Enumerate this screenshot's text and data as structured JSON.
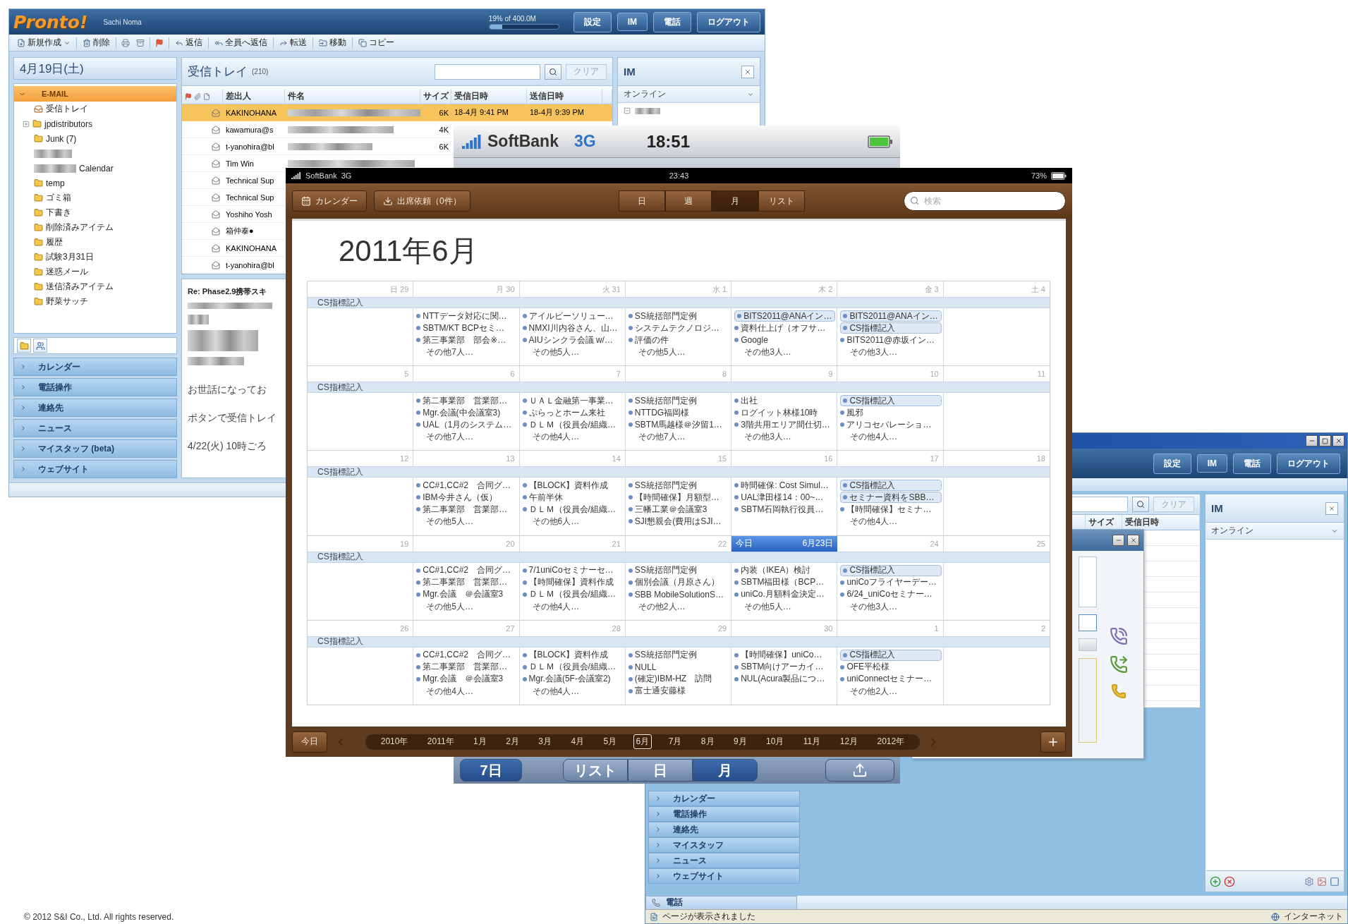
{
  "mail_window": {
    "logo": "Pronto!",
    "user": "Sachi Noma",
    "quota": {
      "reading": "19% of 400.0M",
      "level": 0.19
    },
    "header_buttons": [
      "設定",
      "IM",
      "電話",
      "ログアウト"
    ],
    "toolbar": [
      "新規作成",
      "削除",
      "返信",
      "全員へ返信",
      "転送",
      "移動",
      "コピー"
    ],
    "date": "4月19日(土)",
    "section": {
      "label": "E-MAIL",
      "expanded": true
    },
    "folders": [
      {
        "kind": "inbox",
        "label": "受信トレイ"
      },
      {
        "kind": "collapsed",
        "label": "jpdistributors"
      },
      {
        "kind": "folder",
        "label": "Junk (7)"
      },
      {
        "kind": "redacted"
      },
      {
        "kind": "partly-redacted",
        "label": "Calendar"
      },
      {
        "kind": "folder",
        "label": "temp"
      },
      {
        "kind": "folder",
        "label": "ゴミ箱"
      },
      {
        "kind": "folder",
        "label": "下書き"
      },
      {
        "kind": "folder",
        "label": "削除済みアイテム"
      },
      {
        "kind": "folder",
        "label": "履歴"
      },
      {
        "kind": "folder",
        "label": "試験3月31日"
      },
      {
        "kind": "folder",
        "label": "迷惑メール"
      },
      {
        "kind": "folder",
        "label": "送信済みアイテム"
      },
      {
        "kind": "folder",
        "label": "野菜サッチ"
      }
    ],
    "nav": [
      "カレンダー",
      "電話操作",
      "連絡先",
      "ニュース",
      "マイスタッフ (beta)",
      "ウェブサイト"
    ],
    "list": {
      "title": "受信トレイ",
      "count": "(210)",
      "clear": "クリア",
      "columns": [
        "差出人",
        "件名",
        "サイズ",
        "受信日時",
        "送信日時"
      ],
      "rows": [
        {
          "from": "KAKINOHANA",
          "size": "6K",
          "received": "18-4月 9:41 PM",
          "sent": "18-4月 9:39 PM",
          "selected": true
        },
        {
          "from": "kawamura@s",
          "size": "4K",
          "selected": false
        },
        {
          "from": "t-yanohira@bl",
          "size": "6K",
          "selected": false
        },
        {
          "from": "Tim Win",
          "selected": false
        },
        {
          "from": "Technical Sup",
          "selected": false
        },
        {
          "from": "Technical Sup",
          "selected": false
        },
        {
          "from": "Yoshiho Yosh",
          "selected": false
        },
        {
          "from": "箱仲泰●",
          "selected": false
        },
        {
          "from": "KAKINOHANA",
          "selected": false
        },
        {
          "from": "t-yanohira@bl",
          "selected": false
        }
      ]
    },
    "preview": {
      "subject": "Re: Phase2.9携帯スキ",
      "lines": [
        "お世話になってお",
        "ボタンで受信トレイ",
        "4/22(火) 10時ごろ"
      ]
    },
    "im": {
      "title": "IM",
      "status": "オンライン"
    }
  },
  "desktop_window": {
    "header_buttons": [
      "設定",
      "IM",
      "電話",
      "ログアウト"
    ],
    "clear": "クリア",
    "columns": [
      "サイズ",
      "受信日時"
    ],
    "im": {
      "title": "IM",
      "status": "オンライン"
    },
    "nav": [
      "カレンダー",
      "電話操作",
      "連絡先",
      "マイスタッフ",
      "ニュース",
      "ウェブサイト"
    ],
    "phone_tab": "電話",
    "status_text": "ページが表示されました",
    "zone": "インターネット"
  },
  "phone": {
    "carrier": "SoftBank",
    "network": "3G",
    "time": "18:51",
    "left_button": "7日",
    "tabs": [
      {
        "label": "リスト",
        "selected": false
      },
      {
        "label": "日",
        "selected": false
      },
      {
        "label": "月",
        "selected": true
      }
    ]
  },
  "ipad": {
    "carrier": "SoftBank",
    "network": "3G",
    "time": "23:43",
    "battery": "73%",
    "calendars": "カレンダー",
    "invites": "出席依頼（0件）",
    "views": [
      {
        "label": "日",
        "selected": false
      },
      {
        "label": "週",
        "selected": false
      },
      {
        "label": "月",
        "selected": true
      },
      {
        "label": "リスト",
        "selected": false
      }
    ],
    "search_placeholder": "検索",
    "title": "2011年6月",
    "weeks": [
      {
        "days": [
          {
            "kind": "day",
            "label": "日 29"
          },
          {
            "kind": "day",
            "label": "月 30"
          },
          {
            "kind": "day",
            "label": "火 31"
          },
          {
            "kind": "day",
            "label": "水 1"
          },
          {
            "kind": "day",
            "label": "木 2"
          },
          {
            "kind": "day",
            "label": "金 3"
          },
          {
            "kind": "day",
            "label": "土 4"
          }
        ],
        "band": "CS指標記入",
        "events": [
          [
            {
              "kind": "timed",
              "text": "NTTデータ対応に関…"
            },
            {
              "kind": "timed",
              "text": "SBTM/KT BCPセミ…"
            },
            {
              "kind": "timed",
              "text": "第三事業部　部会※…"
            },
            {
              "kind": "more",
              "text": "その他7人…"
            }
          ],
          [
            {
              "kind": "timed",
              "text": "アイルビーソリュー…"
            },
            {
              "kind": "timed",
              "text": "NMXI川内谷さん、山…"
            },
            {
              "kind": "timed",
              "text": "AIUシンクラ会議 w/…"
            },
            {
              "kind": "more",
              "text": "その他5人…"
            }
          ],
          [
            {
              "kind": "timed",
              "text": "SS統括部門定例"
            },
            {
              "kind": "timed",
              "text": "システムテクノロジ…"
            },
            {
              "kind": "timed",
              "text": "評価の件"
            },
            {
              "kind": "more",
              "text": "その他5人…"
            }
          ],
          [
            {
              "kind": "allday",
              "text": "BITS2011@ANAイン…"
            },
            {
              "kind": "timed",
              "text": "資料仕上げ（オフサ…"
            },
            {
              "kind": "timed",
              "text": "Google"
            },
            {
              "kind": "more",
              "text": "その他3人…"
            }
          ],
          [
            {
              "kind": "allday",
              "text": "BITS2011@ANAイン…"
            },
            {
              "kind": "allday",
              "text": "CS指標記入"
            },
            {
              "kind": "timed",
              "text": "BITS2011@赤坂イン…"
            },
            {
              "kind": "more",
              "text": "その他3人…"
            }
          ]
        ]
      },
      {
        "days": [
          {
            "kind": "day",
            "label": "5"
          },
          {
            "kind": "day",
            "label": "6"
          },
          {
            "kind": "day",
            "label": "7"
          },
          {
            "kind": "day",
            "label": "8"
          },
          {
            "kind": "day",
            "label": "9"
          },
          {
            "kind": "day",
            "label": "10"
          },
          {
            "kind": "day",
            "label": "11"
          }
        ],
        "band": "CS指標記入",
        "events": [
          [
            {
              "kind": "timed",
              "text": "第二事業部　営業部…"
            },
            {
              "kind": "timed",
              "text": "Mgr.会議(中会議室3)"
            },
            {
              "kind": "timed",
              "text": "UAL（1月のシステム…"
            },
            {
              "kind": "more",
              "text": "その他7人…"
            }
          ],
          [
            {
              "kind": "timed",
              "text": "ＵＡＬ金融第一事業…"
            },
            {
              "kind": "timed",
              "text": "ぷらっとホーム来社"
            },
            {
              "kind": "timed",
              "text": "ＤＬＭ（役員会/組織…"
            },
            {
              "kind": "more",
              "text": "その他4人…"
            }
          ],
          [
            {
              "kind": "timed",
              "text": "SS統括部門定例"
            },
            {
              "kind": "timed",
              "text": "NTTDG福岡様"
            },
            {
              "kind": "timed",
              "text": "SBTM馬越様＠汐留1…"
            },
            {
              "kind": "more",
              "text": "その他7人…"
            }
          ],
          [
            {
              "kind": "timed",
              "text": "出社"
            },
            {
              "kind": "timed",
              "text": "ログイット林様10時"
            },
            {
              "kind": "timed",
              "text": "3階共用エリア間仕切…"
            },
            {
              "kind": "more",
              "text": "その他3人…"
            }
          ],
          [
            {
              "kind": "allday",
              "text": "CS指標記入"
            },
            {
              "kind": "timed",
              "text": "風邪"
            },
            {
              "kind": "timed",
              "text": "アリコセパレーショ…"
            },
            {
              "kind": "more",
              "text": "その他4人…"
            }
          ]
        ]
      },
      {
        "days": [
          {
            "kind": "day",
            "label": "12"
          },
          {
            "kind": "day",
            "label": "13"
          },
          {
            "kind": "day",
            "label": "14"
          },
          {
            "kind": "day",
            "label": "15"
          },
          {
            "kind": "day",
            "label": "16"
          },
          {
            "kind": "day",
            "label": "17"
          },
          {
            "kind": "day",
            "label": "18"
          }
        ],
        "band": "CS指標記入",
        "events": [
          [
            {
              "kind": "timed",
              "text": "CC#1,CC#2　合同グ…"
            },
            {
              "kind": "timed",
              "text": "IBM今井さん（仮）"
            },
            {
              "kind": "timed",
              "text": "第二事業部　営業部…"
            },
            {
              "kind": "more",
              "text": "その他5人…"
            }
          ],
          [
            {
              "kind": "timed",
              "text": "【BLOCK】資料作成"
            },
            {
              "kind": "timed",
              "text": "午前半休"
            },
            {
              "kind": "timed",
              "text": "ＤＬＭ（役員会/組織…"
            },
            {
              "kind": "more",
              "text": "その他6人…"
            }
          ],
          [
            {
              "kind": "timed",
              "text": "SS統括部門定例"
            },
            {
              "kind": "timed",
              "text": "【時間確保】月額型…"
            },
            {
              "kind": "timed",
              "text": "三幡工業＠会議室3"
            },
            {
              "kind": "timed",
              "text": "SJI懇親会(費用はSJI…"
            }
          ],
          [
            {
              "kind": "timed",
              "text": "時間確保: Cost Simul…"
            },
            {
              "kind": "timed",
              "text": "UAL津田様14：00~…"
            },
            {
              "kind": "timed",
              "text": "SBTM石岡執行役員…"
            }
          ],
          [
            {
              "kind": "allday",
              "text": "CS指標記入"
            },
            {
              "kind": "allday",
              "text": "セミナー資料をSBB…"
            },
            {
              "kind": "timed",
              "text": "【時間確保】セミナ…"
            },
            {
              "kind": "more",
              "text": "その他4人…"
            }
          ]
        ]
      },
      {
        "days": [
          {
            "kind": "day",
            "label": "19"
          },
          {
            "kind": "day",
            "label": "20"
          },
          {
            "kind": "day",
            "label": "21"
          },
          {
            "kind": "day",
            "label": "22"
          },
          {
            "kind": "today",
            "label": "今日",
            "date": "6月23日"
          },
          {
            "kind": "day",
            "label": "24"
          },
          {
            "kind": "day",
            "label": "25"
          }
        ],
        "band": "CS指標記入",
        "events": [
          [
            {
              "kind": "timed",
              "text": "CC#1,CC#2　合同グ…"
            },
            {
              "kind": "timed",
              "text": "第二事業部　営業部…"
            },
            {
              "kind": "timed",
              "text": "Mgr.会議　＠会議室3"
            },
            {
              "kind": "more",
              "text": "その他5人…"
            }
          ],
          [
            {
              "kind": "timed",
              "text": "7/1uniCoセミナーセ…"
            },
            {
              "kind": "timed",
              "text": "【時間確保】資料作成"
            },
            {
              "kind": "timed",
              "text": "ＤＬＭ（役員会/組織…"
            },
            {
              "kind": "more",
              "text": "その他4人…"
            }
          ],
          [
            {
              "kind": "timed",
              "text": "SS統括部門定例"
            },
            {
              "kind": "timed",
              "text": "個別会議（月原さん）"
            },
            {
              "kind": "timed",
              "text": "SBB MobileSolutionS…"
            },
            {
              "kind": "more",
              "text": "その他2人…"
            }
          ],
          [
            {
              "kind": "timed",
              "text": "内装（IKEA）検討"
            },
            {
              "kind": "timed",
              "text": "SBTM福田様（BCP…"
            },
            {
              "kind": "timed",
              "text": "uniCo.月額料金決定…"
            },
            {
              "kind": "more",
              "text": "その他5人…"
            }
          ],
          [
            {
              "kind": "allday",
              "text": "CS指標記入"
            },
            {
              "kind": "timed",
              "text": "uniCoフライヤーデー…"
            },
            {
              "kind": "timed",
              "text": "6/24_uniCoセミナー…"
            },
            {
              "kind": "more",
              "text": "その他3人…"
            }
          ]
        ]
      },
      {
        "days": [
          {
            "kind": "day",
            "label": "26"
          },
          {
            "kind": "day",
            "label": "27"
          },
          {
            "kind": "day",
            "label": "28"
          },
          {
            "kind": "day",
            "label": "29"
          },
          {
            "kind": "day",
            "label": "30"
          },
          {
            "kind": "day",
            "label": "1"
          },
          {
            "kind": "day",
            "label": "2"
          }
        ],
        "band": "CS指標記入",
        "events": [
          [
            {
              "kind": "timed",
              "text": "CC#1,CC#2　合同グ…"
            },
            {
              "kind": "timed",
              "text": "第二事業部　営業部…"
            },
            {
              "kind": "timed",
              "text": "Mgr.会議　＠会議室3"
            },
            {
              "kind": "more",
              "text": "その他4人…"
            }
          ],
          [
            {
              "kind": "timed",
              "text": "【BLOCK】資料作成"
            },
            {
              "kind": "timed",
              "text": "ＤＬＭ（役員会/組織…"
            },
            {
              "kind": "timed",
              "text": "Mgr.会議(5F-会議室2)"
            },
            {
              "kind": "more",
              "text": "その他4人…"
            }
          ],
          [
            {
              "kind": "timed",
              "text": "SS統括部門定例"
            },
            {
              "kind": "timed",
              "text": "NULL"
            },
            {
              "kind": "timed",
              "text": "(確定)IBM-HZ　訪問"
            },
            {
              "kind": "timed",
              "text": "富士通安藤様"
            }
          ],
          [
            {
              "kind": "timed",
              "text": "【時間確保】uniCo…"
            },
            {
              "kind": "timed",
              "text": "SBTM向けアーカイ…"
            },
            {
              "kind": "timed",
              "text": "NUL(Acura製品につ…"
            }
          ],
          [
            {
              "kind": "allday",
              "text": "CS指標記入"
            },
            {
              "kind": "timed",
              "text": "OFE平松様"
            },
            {
              "kind": "timed",
              "text": "uniConnectセミナー…"
            },
            {
              "kind": "more",
              "text": "その他2人…"
            }
          ]
        ]
      }
    ],
    "today_button": "今日",
    "timeline": [
      {
        "label": "2010年",
        "selected": false
      },
      {
        "label": "2011年",
        "selected": false
      },
      {
        "label": "1月",
        "selected": false
      },
      {
        "label": "2月",
        "selected": false
      },
      {
        "label": "3月",
        "selected": false
      },
      {
        "label": "4月",
        "selected": false
      },
      {
        "label": "5月",
        "selected": false
      },
      {
        "label": "6月",
        "selected": true
      },
      {
        "label": "7月",
        "selected": false
      },
      {
        "label": "8月",
        "selected": false
      },
      {
        "label": "9月",
        "selected": false
      },
      {
        "label": "10月",
        "selected": false
      },
      {
        "label": "11月",
        "selected": false
      },
      {
        "label": "12月",
        "selected": false
      },
      {
        "label": "2012年",
        "selected": false
      }
    ]
  },
  "copyright": "© 2012 S&I Co., Ltd. All rights reserved."
}
